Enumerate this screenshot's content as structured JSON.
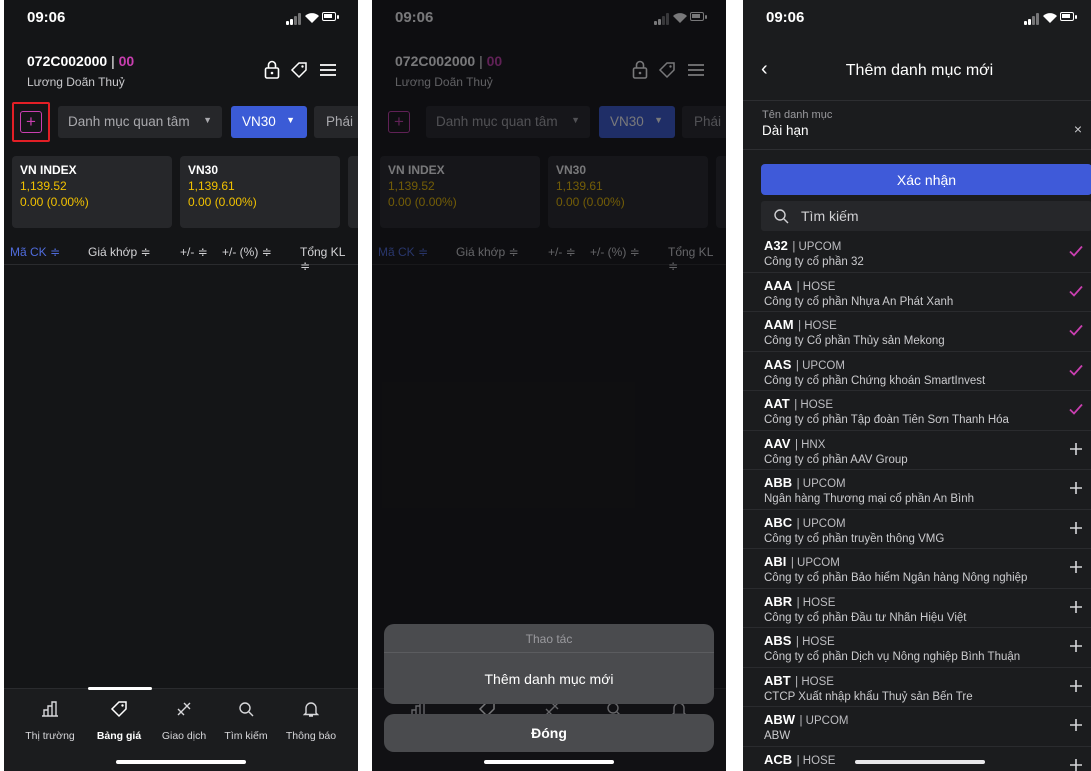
{
  "status": {
    "time": "09:06"
  },
  "header": {
    "account_id": "072C002000",
    "separator": "|",
    "sub_account": "00",
    "user_name": "Lương Doãn Thuỷ",
    "icons": [
      "lock-icon",
      "tag-icon",
      "menu-icon"
    ]
  },
  "filters": {
    "add_button": "+",
    "watchlist_dropdown": "Danh mục quan tâm",
    "index_dropdown": "VN30",
    "partial_tab": "Phái"
  },
  "indices": [
    {
      "name": "VN INDEX",
      "value": "1,139.52",
      "change": "0.00 (0.00%)"
    },
    {
      "name": "VN30",
      "value": "1,139.61",
      "change": "0.00 (0.00%)"
    }
  ],
  "table_headers": [
    "Mã CK ≑",
    "Giá khớp ≑",
    "+/- ≑",
    "+/- (%) ≑",
    "Tổng KL ≑"
  ],
  "tabs": [
    {
      "label": "Thị trường",
      "icon": "chart-icon"
    },
    {
      "label": "Bảng giá",
      "icon": "tag-icon"
    },
    {
      "label": "Giao dịch",
      "icon": "trade-icon"
    },
    {
      "label": "Tìm kiếm",
      "icon": "search-icon"
    },
    {
      "label": "Thông báo",
      "icon": "bell-icon"
    }
  ],
  "action_sheet": {
    "title": "Thao tác",
    "option": "Thêm danh mục mới",
    "close": "Đóng"
  },
  "new_watchlist": {
    "back_icon": "chevron-left-icon",
    "title": "Thêm danh mục mới",
    "name_label": "Tên danh mục",
    "name_value": "Dài hạn",
    "clear": "×",
    "confirm": "Xác nhận",
    "search_placeholder": "Tìm kiếm",
    "stocks": [
      {
        "code": "A32",
        "exchange": "| UPCOM",
        "name": "Công ty cổ phần 32",
        "added": true
      },
      {
        "code": "AAA",
        "exchange": "| HOSE",
        "name": "Công ty cổ phần Nhựa An Phát Xanh",
        "added": true
      },
      {
        "code": "AAM",
        "exchange": "| HOSE",
        "name": "Công ty Cổ phần Thủy sản Mekong",
        "added": true
      },
      {
        "code": "AAS",
        "exchange": "| UPCOM",
        "name": "Công ty cổ phần Chứng khoán SmartInvest",
        "added": true
      },
      {
        "code": "AAT",
        "exchange": "| HOSE",
        "name": "Công ty cổ phần Tập đoàn Tiên Sơn Thanh Hóa",
        "added": true
      },
      {
        "code": "AAV",
        "exchange": "| HNX",
        "name": "Công ty cổ phần AAV Group",
        "added": false
      },
      {
        "code": "ABB",
        "exchange": "| UPCOM",
        "name": "Ngân hàng Thương mại cổ phần An Bình",
        "added": false
      },
      {
        "code": "ABC",
        "exchange": "| UPCOM",
        "name": "Công ty cổ phần truyền thông VMG",
        "added": false
      },
      {
        "code": "ABI",
        "exchange": "| UPCOM",
        "name": "Công ty cổ phần Bảo hiểm Ngân hàng Nông nghiệp",
        "added": false
      },
      {
        "code": "ABR",
        "exchange": "| HOSE",
        "name": "Công ty cổ phần Đầu tư Nhãn Hiệu Việt",
        "added": false
      },
      {
        "code": "ABS",
        "exchange": "| HOSE",
        "name": "Công ty cổ phần Dịch vụ Nông nghiệp Bình Thuận",
        "added": false
      },
      {
        "code": "ABT",
        "exchange": "| HOSE",
        "name": "CTCP Xuất nhập khẩu Thuỷ sản Bến Tre",
        "added": false
      },
      {
        "code": "ABW",
        "exchange": "| UPCOM",
        "name": "ABW",
        "added": false
      },
      {
        "code": "ACB",
        "exchange": "| HOSE",
        "name": "",
        "added": false
      }
    ]
  },
  "colors": {
    "accent_purple": "#c93fb0",
    "accent_blue": "#3b5bd6",
    "price_yellow": "#f2c200",
    "highlight_red": "#e21f26"
  }
}
